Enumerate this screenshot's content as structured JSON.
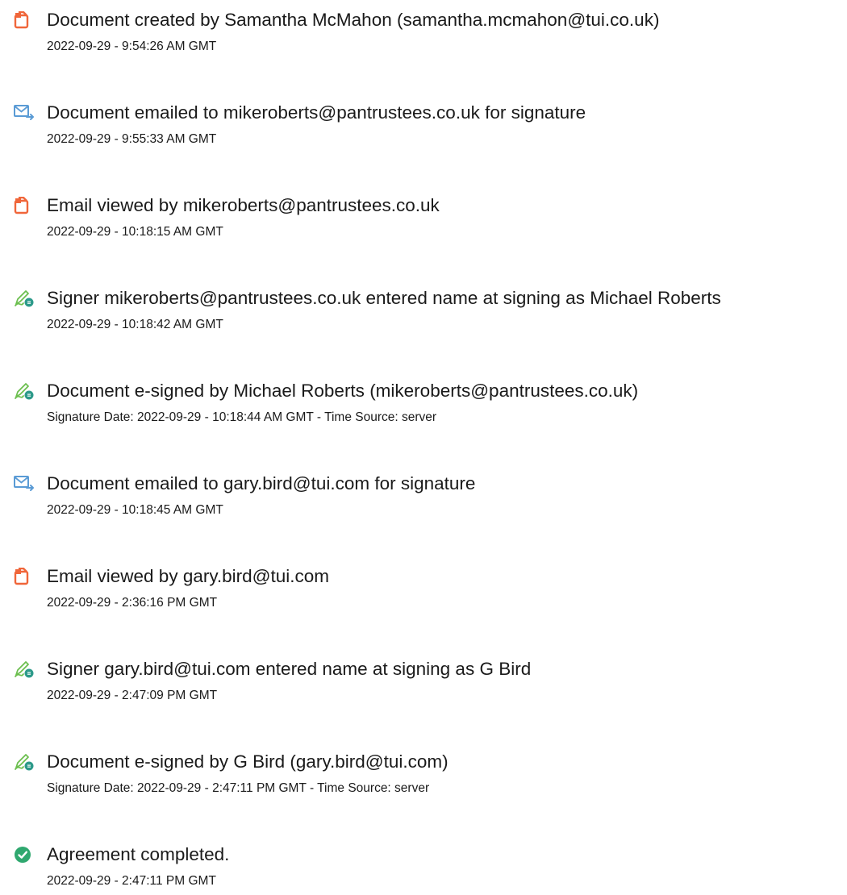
{
  "events": [
    {
      "icon": "document-created-icon",
      "title": "Document created by Samantha McMahon (samantha.mcmahon@tui.co.uk)",
      "detail": "2022-09-29 - 9:54:26 AM GMT"
    },
    {
      "icon": "email-sent-icon",
      "title": "Document emailed to mikeroberts@pantrustees.co.uk for signature",
      "detail": "2022-09-29 - 9:55:33 AM GMT"
    },
    {
      "icon": "document-viewed-icon",
      "title": "Email viewed by mikeroberts@pantrustees.co.uk",
      "detail": "2022-09-29 - 10:18:15 AM GMT"
    },
    {
      "icon": "esign-pen-icon",
      "title": "Signer mikeroberts@pantrustees.co.uk entered name at signing as Michael Roberts",
      "detail": "2022-09-29 - 10:18:42 AM GMT"
    },
    {
      "icon": "esign-pen-icon",
      "title": "Document e-signed by Michael Roberts (mikeroberts@pantrustees.co.uk)",
      "detail": "Signature Date: 2022-09-29 - 10:18:44 AM GMT - Time Source: server"
    },
    {
      "icon": "email-sent-icon",
      "title": "Document emailed to gary.bird@tui.com for signature",
      "detail": "2022-09-29 - 10:18:45 AM GMT"
    },
    {
      "icon": "document-viewed-icon",
      "title": "Email viewed by gary.bird@tui.com",
      "detail": "2022-09-29 - 2:36:16 PM GMT"
    },
    {
      "icon": "esign-pen-icon",
      "title": "Signer gary.bird@tui.com entered name at signing as G Bird",
      "detail": "2022-09-29 - 2:47:09 PM GMT"
    },
    {
      "icon": "esign-pen-icon",
      "title": "Document e-signed by G Bird (gary.bird@tui.com)",
      "detail": "Signature Date: 2022-09-29 - 2:47:11 PM GMT - Time Source: server"
    },
    {
      "icon": "agreement-completed-check-icon",
      "title": "Agreement completed.",
      "detail": "2022-09-29 - 2:47:11 PM GMT"
    }
  ],
  "colors": {
    "document_icon": "#f0663a",
    "email_icon": "#5a9bd5",
    "esign_pen": "#6cbf4f",
    "esign_badge": "#2d9a8a",
    "completed_check": "#2fa86f"
  }
}
